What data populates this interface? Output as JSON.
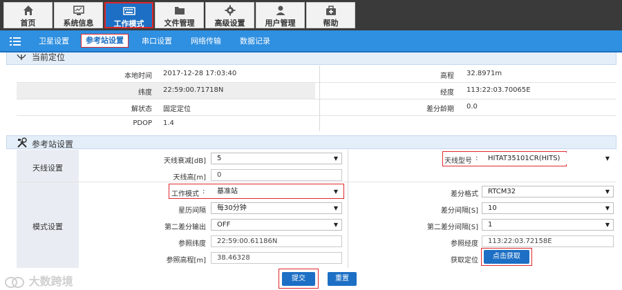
{
  "top_nav": {
    "items": [
      {
        "label": "首页",
        "icon": "home-icon"
      },
      {
        "label": "系统信息",
        "icon": "monitor-icon"
      },
      {
        "label": "工作模式",
        "icon": "keyboard-icon",
        "active": true
      },
      {
        "label": "文件管理",
        "icon": "folder-icon"
      },
      {
        "label": "高级设置",
        "icon": "gear-icon"
      },
      {
        "label": "用户管理",
        "icon": "user-icon"
      },
      {
        "label": "帮助",
        "icon": "toolbox-icon"
      }
    ]
  },
  "sub_nav": {
    "items": [
      {
        "label": "卫星设置"
      },
      {
        "label": "参考站设置",
        "active": true
      },
      {
        "label": "串口设置"
      },
      {
        "label": "网络传输"
      },
      {
        "label": "数据记录"
      }
    ]
  },
  "position_panel": {
    "title": "当前定位",
    "rows": [
      {
        "label_left": "本地时间",
        "value_left": "2017-12-28 17:03:40",
        "label_right": "高程",
        "value_right": "32.8971m"
      },
      {
        "label_left": "纬度",
        "value_left": "22:59:00.71718N",
        "label_right": "经度",
        "value_right": "113:22:03.70065E"
      },
      {
        "label_left": "解状态",
        "value_left": "固定定位",
        "label_right": "差分龄期",
        "value_right": "0.0"
      },
      {
        "label_left": "PDOP",
        "value_left": "1.4"
      }
    ]
  },
  "ref_panel": {
    "title": "参考站设置",
    "antenna_group": "天线设置",
    "mode_group": "模式设置",
    "antenna_atten_label": "天线衰减[dB]",
    "antenna_atten_value": "5",
    "antenna_height_label": "天线高[m]",
    "antenna_height_value": "0",
    "antenna_model_label": "天线型号",
    "antenna_model_value": "HITAT35101CR(HITS)",
    "work_mode_label": "工作模式",
    "work_mode_value": "基准站",
    "diff_format_label": "差分格式",
    "diff_format_value": "RTCM32",
    "ephem_interval_label": "星历间隔",
    "ephem_interval_value": "每30分钟",
    "diff_interval_label": "差分间隔[S]",
    "diff_interval_value": "10",
    "second_diff_output_label": "第二差分输出",
    "second_diff_output_value": "OFF",
    "second_diff_interval_label": "第二差分间隔[S]",
    "second_diff_interval_value": "1",
    "ref_lat_label": "参照纬度",
    "ref_lat_value": "22:59:00.61186N",
    "ref_lon_label": "参照经度",
    "ref_lon_value": "113:22:03.72158E",
    "ref_height_label": "参照高程[m]",
    "ref_height_value": "38.46328",
    "get_position_label": "获取定位",
    "get_position_button": "点击获取",
    "colon": ":"
  },
  "actions": {
    "submit": "提交",
    "reset": "重置"
  },
  "watermark": "大数跨境",
  "colors": {
    "nav_bg": "#3a3a3a",
    "accent": "#1c6fc4",
    "subnav": "#2f8fe0",
    "highlight": "#e0262b"
  }
}
